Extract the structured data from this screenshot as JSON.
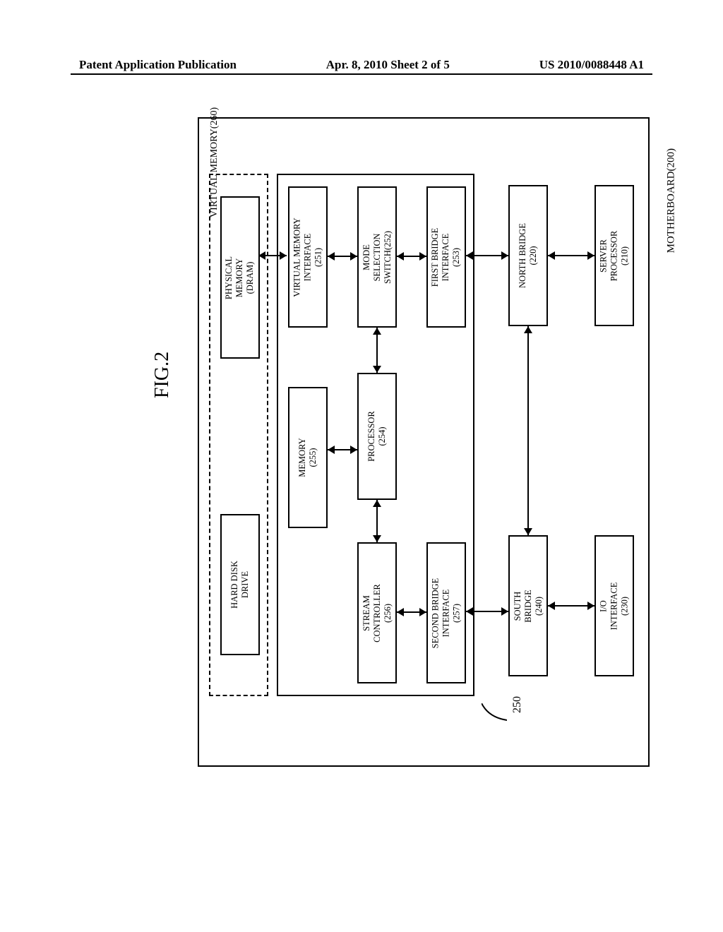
{
  "header": {
    "left": "Patent Application Publication",
    "mid": "Apr. 8, 2010  Sheet 2 of 5",
    "right": "US 2010/0088448 A1"
  },
  "figure": {
    "label": "FIG.2",
    "motherboard": "MOTHERBOARD(200)",
    "virtual_memory": "VIRTUAL MEMORY(260)",
    "ref250": "250",
    "boxes": {
      "server_processor": "SERVER\nPROCESSOR\n(210)",
      "north_bridge": "NORTH BRIDGE\n(220)",
      "io_interface": "I/O\nINTERFACE\n(230)",
      "south_bridge": "SOUTH\nBRIDGE\n(240)",
      "vm_interface": "VIRTUAL MEMORY\nINTERFACE\n(251)",
      "mode_switch": "MODE\nSELECTION\nSWITCH(252)",
      "first_bridge_if": "FIRST BRIDGE\nINTERFACE\n(253)",
      "processor": "PROCESSOR\n(254)",
      "memory": "MEMORY\n(255)",
      "stream_controller": "STREAM\nCONTROLLER\n(256)",
      "second_bridge_if": "SECOND BRIDGE\nINTERFACE\n(257)",
      "physical_memory": "PHYSICAL\nMEMORY\n(DRAM)",
      "hdd": "HARD DISK\nDRIVE"
    }
  }
}
